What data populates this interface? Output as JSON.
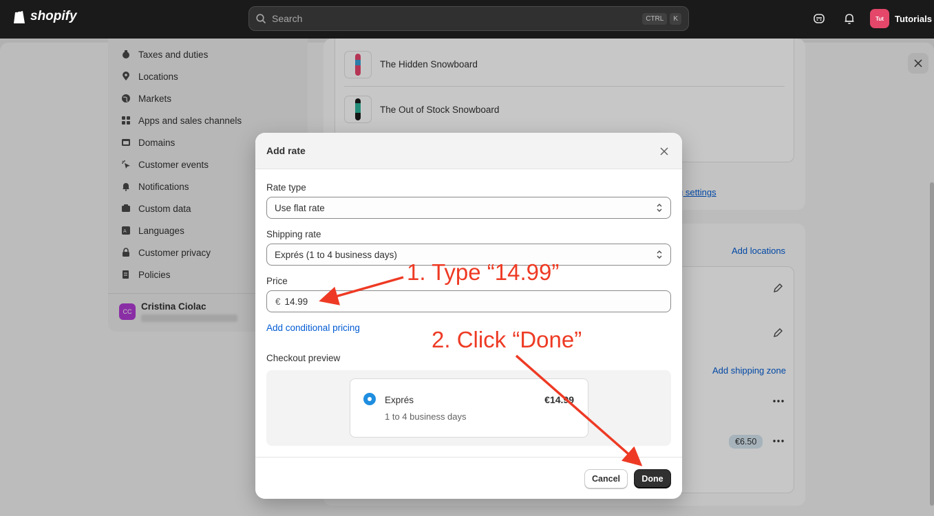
{
  "topbar": {
    "logo_text": "shopify",
    "search_placeholder": "Search",
    "shortcut_keys": [
      "CTRL",
      "K"
    ],
    "store_initials": "Tut",
    "store_name": "Tutorials"
  },
  "sidebar": {
    "items": [
      {
        "label": "Taxes and duties",
        "icon": "tax-icon"
      },
      {
        "label": "Locations",
        "icon": "location-pin-icon"
      },
      {
        "label": "Markets",
        "icon": "globe-icon"
      },
      {
        "label": "Apps and sales channels",
        "icon": "apps-icon"
      },
      {
        "label": "Domains",
        "icon": "domain-icon"
      },
      {
        "label": "Customer events",
        "icon": "events-icon"
      },
      {
        "label": "Notifications",
        "icon": "bell-icon"
      },
      {
        "label": "Custom data",
        "icon": "data-icon"
      },
      {
        "label": "Languages",
        "icon": "language-icon"
      },
      {
        "label": "Customer privacy",
        "icon": "lock-icon"
      },
      {
        "label": "Policies",
        "icon": "policy-icon"
      }
    ],
    "user": {
      "initials": "CC",
      "name": "Cristina Ciolac"
    }
  },
  "background": {
    "products": [
      "The Hidden Snowboard",
      "The Out of Stock Snowboard"
    ],
    "settings_link": "g settings",
    "add_locations": "Add locations",
    "add_shipping_zone": "Add shipping zone",
    "rate_badge": "€6.50"
  },
  "modal": {
    "title": "Add rate",
    "rate_type": {
      "label": "Rate type",
      "value": "Use flat rate"
    },
    "shipping_rate": {
      "label": "Shipping rate",
      "value": "Exprés (1 to 4 business days)"
    },
    "price": {
      "label": "Price",
      "currency": "€",
      "value": "14.99"
    },
    "conditional_link": "Add conditional pricing",
    "preview": {
      "label": "Checkout preview",
      "name": "Exprés",
      "subtitle": "1 to 4 business days",
      "price": "€14.99"
    },
    "cancel_label": "Cancel",
    "done_label": "Done"
  },
  "annotations": {
    "step1": "1. Type “14.99”",
    "step2": "2. Click “Done”"
  },
  "colors": {
    "annotation": "#ee3a24",
    "primary_button": "#303030",
    "link": "#005bd3",
    "radio": "#1f8ee0"
  }
}
